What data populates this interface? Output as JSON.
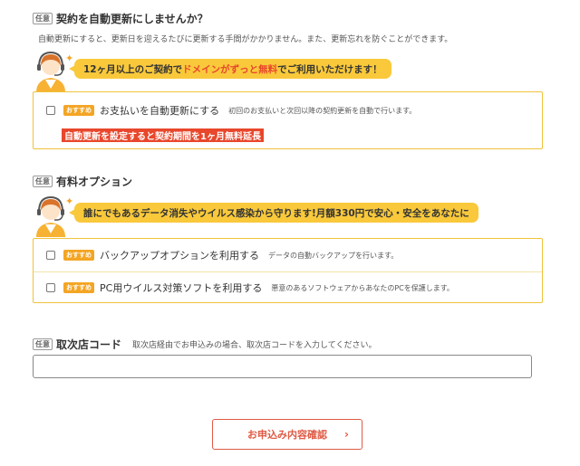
{
  "tag_optional": "任意",
  "auto_renew": {
    "heading": "契約を自動更新にしませんか？",
    "description": "自動更新にすると、更新日を迎えるたびに更新する手間がかかりません。また、更新忘れを防ぐことができます。",
    "bubble": {
      "pre": "12ヶ月以上のご契約で",
      "accent": "ドメインがずっと無料",
      "post": "でご利用いただけます！"
    },
    "option": {
      "badge": "おすすめ",
      "label": "お支払いを自動更新にする",
      "note": "初回のお支払いと次回以降の契約更新を自動で行います。",
      "checked": false
    },
    "promo": "自動更新を設定すると契約期間を1ヶ月無料延長"
  },
  "paid_options": {
    "heading": "有料オプション",
    "bubble": "誰にでもあるデータ消失やウイルス感染から守ります!月額330円で安心・安全をあなたに",
    "items": [
      {
        "badge": "おすすめ",
        "label": "バックアップオプションを利用する",
        "note": "データの自動バックアップを行います。",
        "checked": false
      },
      {
        "badge": "おすすめ",
        "label": "PC用ウイルス対策ソフトを利用する",
        "note": "悪意のあるソフトウェアからあなたのPCを保護します。",
        "checked": false
      }
    ]
  },
  "agency_code": {
    "heading": "取次店コード",
    "note": "取次店経由でお申込みの場合、取次店コードを入力してください。",
    "value": "",
    "placeholder": ""
  },
  "submit": {
    "label": "お申込み内容確認",
    "chevron": "›"
  },
  "icons": {
    "avatar": "support-operator-icon",
    "sparkle": "✦"
  },
  "colors": {
    "yellow": "#f9c93b",
    "orange": "#f4a524",
    "red": "#e8472c",
    "border": "#f0c23b"
  }
}
